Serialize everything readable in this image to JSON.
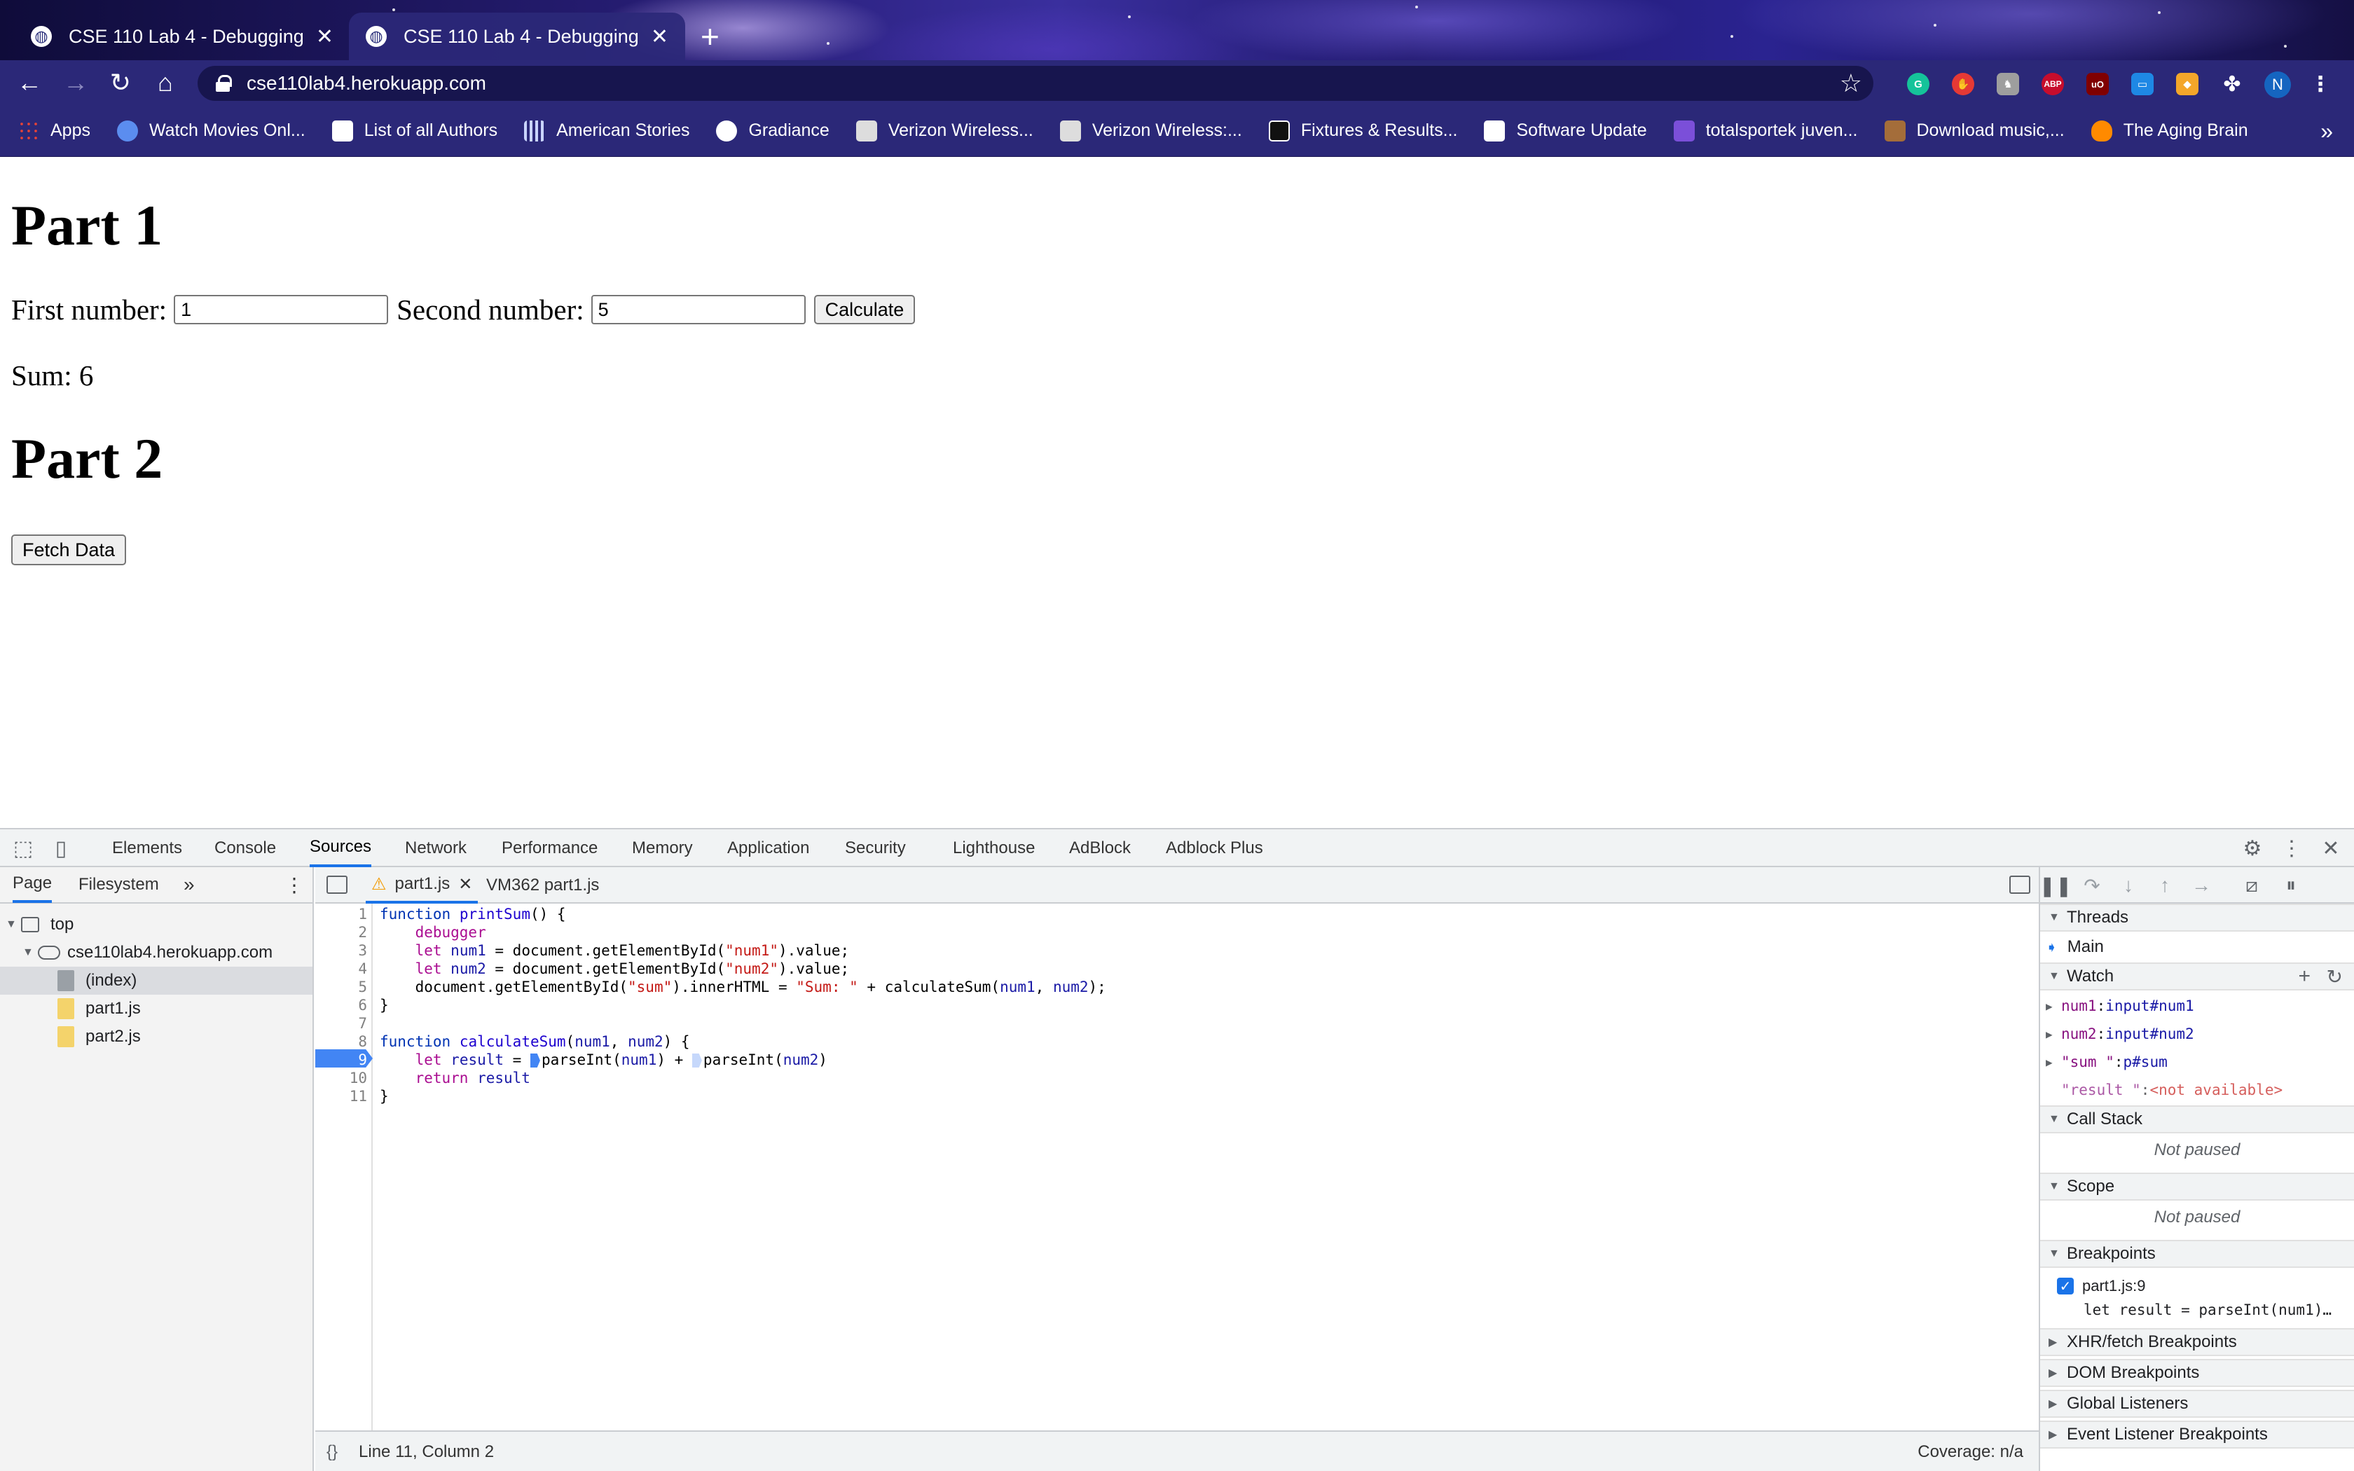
{
  "browser": {
    "tabs": [
      {
        "title": "CSE 110 Lab 4 - Debugging",
        "active": false
      },
      {
        "title": "CSE 110 Lab 4 - Debugging",
        "active": true
      }
    ],
    "new_tab_glyph": "+",
    "close_glyph": "✕",
    "url": "cse110lab4.herokuapp.com",
    "profile_initial": "N",
    "extensions": [
      {
        "name": "grammarly-icon",
        "label": "G",
        "color": "#15c39a"
      },
      {
        "name": "stop-hand-icon",
        "label": "✋",
        "color": "#e53935"
      },
      {
        "name": "gray-extension-icon",
        "label": "♞",
        "color": "#9e9e9e"
      },
      {
        "name": "adblock-plus-icon",
        "label": "ABP",
        "color": "#c70d2c"
      },
      {
        "name": "ublock-origin-icon",
        "label": "uO",
        "color": "#800000"
      },
      {
        "name": "screen-extension-icon",
        "label": "▭",
        "color": "#1e88e5"
      },
      {
        "name": "honey-icon",
        "label": "◆",
        "color": "#f4a62a"
      },
      {
        "name": "puzzle-icon",
        "label": "✤",
        "color": "transparent"
      }
    ],
    "bookmarks": [
      {
        "label": "Apps",
        "icon": "apps-grid-icon",
        "color": "#ea4335"
      },
      {
        "label": "Watch Movies Onl...",
        "icon": "play-circle-icon",
        "color": "#5b8def"
      },
      {
        "label": "List of all Authors",
        "icon": "author-icon",
        "color": "#ffffff"
      },
      {
        "label": "American Stories",
        "icon": "library-icon",
        "color": "#c9d4ff"
      },
      {
        "label": "Gradiance",
        "icon": "globe-icon",
        "color": "#ffffff"
      },
      {
        "label": "Verizon Wireless...",
        "icon": "verizon-icon",
        "color": "#dddddd"
      },
      {
        "label": "Verizon Wireless:...",
        "icon": "verizon-icon",
        "color": "#dddddd"
      },
      {
        "label": "Fixtures & Results...",
        "icon": "juventus-icon",
        "color": "#111111"
      },
      {
        "label": "Software Update",
        "icon": "document-icon",
        "color": "#ffffff"
      },
      {
        "label": "totalsportek juven...",
        "icon": "yahoo-icon",
        "color": "#7b4fd9"
      },
      {
        "label": "Download music,...",
        "icon": "music-icon",
        "color": "#a46d3a"
      },
      {
        "label": "The Aging Brain",
        "icon": "flame-icon",
        "color": "#ff8a00"
      }
    ],
    "bookmarks_more": "»"
  },
  "page": {
    "part1_heading": "Part 1",
    "first_label": "First number:",
    "first_value": "1",
    "second_label": "Second number:",
    "second_value": "5",
    "calculate_label": "Calculate",
    "sum_text": "Sum: 6",
    "part2_heading": "Part 2",
    "fetch_label": "Fetch Data"
  },
  "devtools": {
    "tabs": [
      "Elements",
      "Console",
      "Sources",
      "Network",
      "Performance",
      "Memory",
      "Application",
      "Security",
      "Lighthouse",
      "AdBlock",
      "Adblock Plus"
    ],
    "active_tab": "Sources",
    "navigator": {
      "tabs": [
        "Page",
        "Filesystem"
      ],
      "more": "»",
      "tree": [
        {
          "label": "top",
          "type": "frame"
        },
        {
          "label": "cse110lab4.herokuapp.com",
          "type": "domain"
        },
        {
          "label": "(index)",
          "type": "file-gray",
          "selected": true
        },
        {
          "label": "part1.js",
          "type": "file-yellow"
        },
        {
          "label": "part2.js",
          "type": "file-yellow"
        }
      ]
    },
    "editor": {
      "tabs": [
        {
          "label": "part1.js",
          "warning": true,
          "active": true
        },
        {
          "label": "VM362 part1.js",
          "warning": false,
          "active": false
        }
      ],
      "breakpoint_line": 9,
      "status_left": "Line 11, Column 2",
      "status_right": "Coverage: n/a",
      "format_glyph": "{}"
    },
    "debugger": {
      "threads_title": "Threads",
      "thread_main": "Main",
      "watch_title": "Watch",
      "watch": [
        {
          "key": "num1",
          "val": "input#num1",
          "expandable": true
        },
        {
          "key": "num2",
          "val": "input#num2",
          "expandable": true
        },
        {
          "key": "\"sum \"",
          "val": "p#sum",
          "expandable": true
        },
        {
          "key": "\"result \"",
          "val": "<not available>",
          "expandable": false
        }
      ],
      "callstack_title": "Call Stack",
      "callstack_status": "Not paused",
      "scope_title": "Scope",
      "scope_status": "Not paused",
      "breakpoints_title": "Breakpoints",
      "breakpoint_file": "part1.js:9",
      "breakpoint_code": "let result = parseInt(num1)…",
      "xhr_title": "XHR/fetch Breakpoints",
      "dom_title": "DOM Breakpoints",
      "global_title": "Global Listeners",
      "event_title": "Event Listener Breakpoints"
    }
  }
}
